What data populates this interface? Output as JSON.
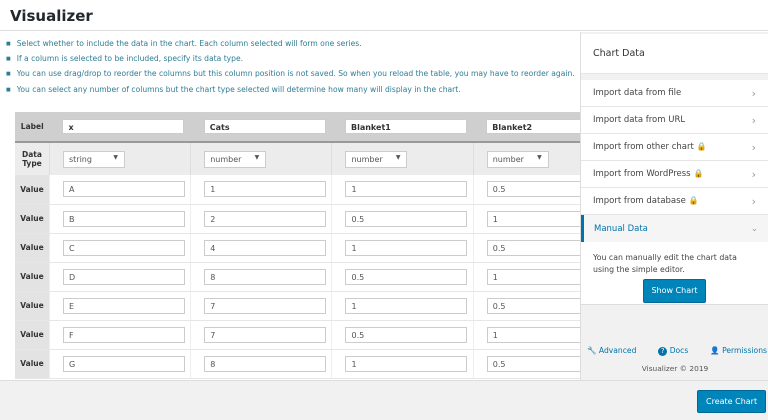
{
  "header": {
    "title": "Visualizer"
  },
  "notes": [
    "Select whether to include the data in the chart. Each column selected will form one series.",
    "If a column is selected to be included, specify its data type.",
    "You can use drag/drop to reorder the columns but this column position is not saved. So when you reload the table, you may have to reorder again.",
    "You can select any number of columns but the chart type selected will determine how many will display in the chart."
  ],
  "table": {
    "label_row": "Label",
    "type_row": "Data Type",
    "value_row": "Value",
    "labels": [
      "x",
      "Cats",
      "Blanket1",
      "Blanket2"
    ],
    "types": [
      "string",
      "number",
      "number",
      "number"
    ],
    "rows": [
      [
        "A",
        "1",
        "1",
        "0.5"
      ],
      [
        "B",
        "2",
        "0.5",
        "1"
      ],
      [
        "C",
        "4",
        "1",
        "0.5"
      ],
      [
        "D",
        "8",
        "0.5",
        "1"
      ],
      [
        "E",
        "7",
        "1",
        "0.5"
      ],
      [
        "F",
        "7",
        "0.5",
        "1"
      ],
      [
        "G",
        "8",
        "1",
        "0.5"
      ]
    ]
  },
  "sidebar": {
    "title": "Chart Data",
    "items": [
      {
        "label": "Import data from file",
        "locked": false
      },
      {
        "label": "Import data from URL",
        "locked": false
      },
      {
        "label": "Import from other chart",
        "locked": true
      },
      {
        "label": "Import from WordPress",
        "locked": true
      },
      {
        "label": "Import from database",
        "locked": true
      }
    ],
    "manual": {
      "label": "Manual Data",
      "text": "You can manually edit the chart data using the simple editor.",
      "button": "Show Chart"
    },
    "links": {
      "advanced": "Advanced",
      "docs": "Docs",
      "permissions": "Permissions"
    },
    "copyright": "Visualizer © 2019"
  },
  "footer": {
    "create": "Create Chart"
  },
  "colors": {
    "accent": "#0085ba",
    "note": "#2e7d94"
  }
}
